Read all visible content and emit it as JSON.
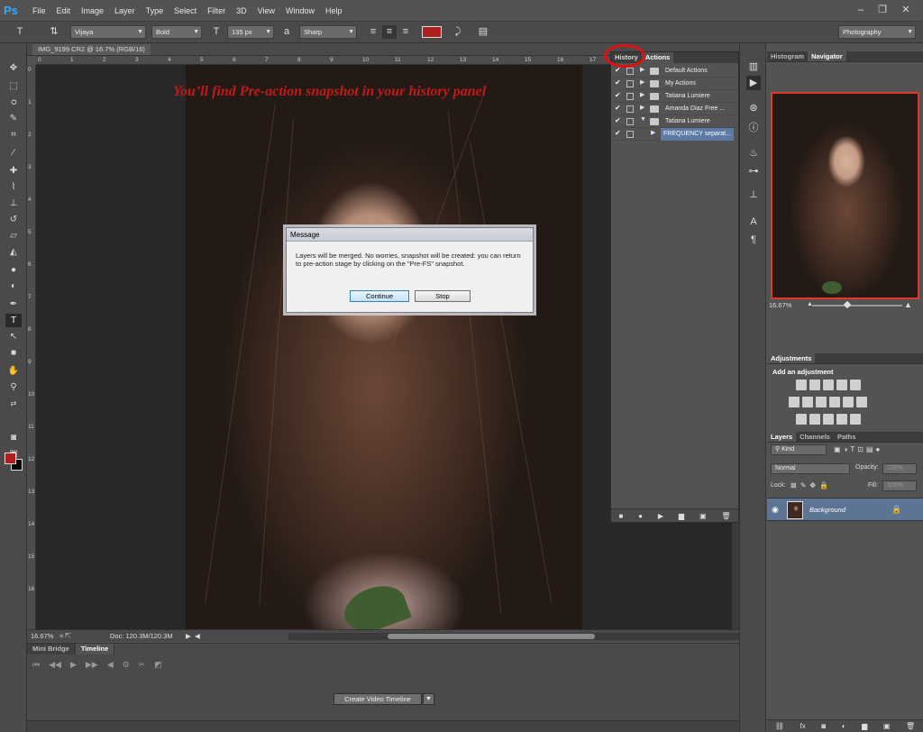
{
  "app": {
    "logo": "Ps"
  },
  "menu": [
    "File",
    "Edit",
    "Image",
    "Layer",
    "Type",
    "Select",
    "Filter",
    "3D",
    "View",
    "Window",
    "Help"
  ],
  "options_bar": {
    "font_family": "Vijaya",
    "font_style": "Bold",
    "font_size": "135 px",
    "antialias": "Sharp",
    "workspace": "Photography",
    "text_color": "#b0201e"
  },
  "document": {
    "tab_title": "IMG_9199.CR2 @ 16.7% (RGB/16)",
    "zoom": "16.67%",
    "doc_info": "Doc: 120.3M/120.3M",
    "annotation": "You’ll find Pre-action snapshot in your history panel",
    "ruler_h": [
      "0",
      "1",
      "2",
      "3",
      "4",
      "5",
      "6",
      "7",
      "8",
      "9",
      "10",
      "11",
      "12",
      "13",
      "14",
      "15",
      "16",
      "17"
    ],
    "ruler_v": [
      "0",
      "1",
      "2",
      "3",
      "4",
      "5",
      "6",
      "7",
      "8",
      "9",
      "10",
      "11",
      "12",
      "13",
      "14",
      "15",
      "16"
    ]
  },
  "timeline": {
    "tabs": [
      "Mini Bridge",
      "Timeline"
    ],
    "create_button": "Create Video Timeline"
  },
  "history_actions": {
    "tabs": [
      "History",
      "Actions"
    ],
    "rows": [
      "Default Actions",
      "My Actions",
      "Tatiana Lumiere",
      "Amanda Diaz Free ...",
      "Tatiana Lumiere"
    ],
    "sub_row": "FREQUENCY separat..."
  },
  "navigator": {
    "tabs": [
      "Histogram",
      "Navigator"
    ],
    "zoom": "16.67%"
  },
  "adjustments": {
    "tab": "Adjustments",
    "title": "Add an adjustment"
  },
  "layers": {
    "tabs": [
      "Layers",
      "Channels",
      "Paths"
    ],
    "filter": "Kind",
    "blend_mode": "Normal",
    "opacity_label": "Opacity:",
    "opacity_value": "100%",
    "lock_label": "Lock:",
    "fill_label": "Fill:",
    "fill_value": "100%",
    "layer_name": "Background"
  },
  "dialog": {
    "title": "Message",
    "message": "Layers will be merged. No worries, snapshot will be created: you can return to pre-action stage by clicking on the \"Pre-FS\" snapshot.",
    "continue": "Continue",
    "stop": "Stop"
  }
}
